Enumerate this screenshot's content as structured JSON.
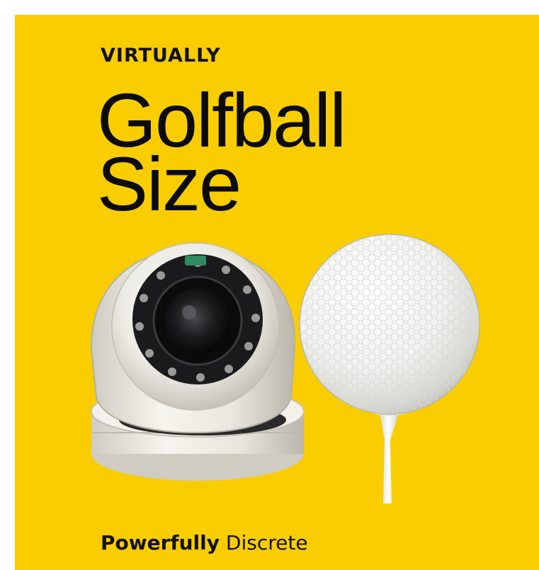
{
  "panel": {
    "background": "#f9cd00",
    "eyebrow": "VIRTUALLY",
    "headline_line1": "Golfball",
    "headline_line2": "Size",
    "tagline_strong": "Powerfully",
    "tagline_rest": "Discrete"
  },
  "images": {
    "camera": "dome-security-camera",
    "ball": "golf-ball-on-tee"
  }
}
